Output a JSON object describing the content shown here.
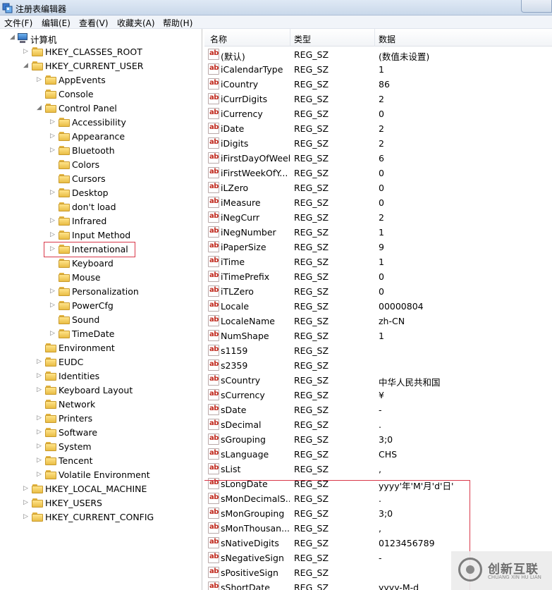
{
  "window": {
    "title": "注册表编辑器"
  },
  "menu": [
    "文件(F)",
    "编辑(E)",
    "查看(V)",
    "收藏夹(A)",
    "帮助(H)"
  ],
  "tree": [
    {
      "label": "计算机",
      "level": 0,
      "expander": "open",
      "kind": "computer"
    },
    {
      "label": "HKEY_CLASSES_ROOT",
      "level": 1,
      "expander": "closed"
    },
    {
      "label": "HKEY_CURRENT_USER",
      "level": 1,
      "expander": "open"
    },
    {
      "label": "AppEvents",
      "level": 2,
      "expander": "closed"
    },
    {
      "label": "Console",
      "level": 2,
      "expander": "none"
    },
    {
      "label": "Control Panel",
      "level": 2,
      "expander": "open"
    },
    {
      "label": "Accessibility",
      "level": 3,
      "expander": "closed"
    },
    {
      "label": "Appearance",
      "level": 3,
      "expander": "closed"
    },
    {
      "label": "Bluetooth",
      "level": 3,
      "expander": "closed"
    },
    {
      "label": "Colors",
      "level": 3,
      "expander": "none"
    },
    {
      "label": "Cursors",
      "level": 3,
      "expander": "none"
    },
    {
      "label": "Desktop",
      "level": 3,
      "expander": "closed"
    },
    {
      "label": "don't load",
      "level": 3,
      "expander": "none"
    },
    {
      "label": "Infrared",
      "level": 3,
      "expander": "closed"
    },
    {
      "label": "Input Method",
      "level": 3,
      "expander": "closed"
    },
    {
      "label": "International",
      "level": 3,
      "expander": "closed",
      "selected": true
    },
    {
      "label": "Keyboard",
      "level": 3,
      "expander": "none"
    },
    {
      "label": "Mouse",
      "level": 3,
      "expander": "none"
    },
    {
      "label": "Personalization",
      "level": 3,
      "expander": "closed"
    },
    {
      "label": "PowerCfg",
      "level": 3,
      "expander": "closed"
    },
    {
      "label": "Sound",
      "level": 3,
      "expander": "none"
    },
    {
      "label": "TimeDate",
      "level": 3,
      "expander": "closed"
    },
    {
      "label": "Environment",
      "level": 2,
      "expander": "none"
    },
    {
      "label": "EUDC",
      "level": 2,
      "expander": "closed"
    },
    {
      "label": "Identities",
      "level": 2,
      "expander": "closed"
    },
    {
      "label": "Keyboard Layout",
      "level": 2,
      "expander": "closed"
    },
    {
      "label": "Network",
      "level": 2,
      "expander": "none"
    },
    {
      "label": "Printers",
      "level": 2,
      "expander": "closed"
    },
    {
      "label": "Software",
      "level": 2,
      "expander": "closed"
    },
    {
      "label": "System",
      "level": 2,
      "expander": "closed"
    },
    {
      "label": "Tencent",
      "level": 2,
      "expander": "closed"
    },
    {
      "label": "Volatile Environment",
      "level": 2,
      "expander": "closed"
    },
    {
      "label": "HKEY_LOCAL_MACHINE",
      "level": 1,
      "expander": "closed"
    },
    {
      "label": "HKEY_USERS",
      "level": 1,
      "expander": "closed"
    },
    {
      "label": "HKEY_CURRENT_CONFIG",
      "level": 1,
      "expander": "closed"
    }
  ],
  "columns": [
    "名称",
    "类型",
    "数据"
  ],
  "values": [
    {
      "name": "(默认)",
      "type": "REG_SZ",
      "data": "(数值未设置)"
    },
    {
      "name": "iCalendarType",
      "type": "REG_SZ",
      "data": "1"
    },
    {
      "name": "iCountry",
      "type": "REG_SZ",
      "data": "86"
    },
    {
      "name": "iCurrDigits",
      "type": "REG_SZ",
      "data": "2"
    },
    {
      "name": "iCurrency",
      "type": "REG_SZ",
      "data": "0"
    },
    {
      "name": "iDate",
      "type": "REG_SZ",
      "data": "2"
    },
    {
      "name": "iDigits",
      "type": "REG_SZ",
      "data": "2"
    },
    {
      "name": "iFirstDayOfWeek",
      "type": "REG_SZ",
      "data": "6"
    },
    {
      "name": "iFirstWeekOfY...",
      "type": "REG_SZ",
      "data": "0"
    },
    {
      "name": "iLZero",
      "type": "REG_SZ",
      "data": "0"
    },
    {
      "name": "iMeasure",
      "type": "REG_SZ",
      "data": "0"
    },
    {
      "name": "iNegCurr",
      "type": "REG_SZ",
      "data": "2"
    },
    {
      "name": "iNegNumber",
      "type": "REG_SZ",
      "data": "1"
    },
    {
      "name": "iPaperSize",
      "type": "REG_SZ",
      "data": "9"
    },
    {
      "name": "iTime",
      "type": "REG_SZ",
      "data": "1"
    },
    {
      "name": "iTimePrefix",
      "type": "REG_SZ",
      "data": "0"
    },
    {
      "name": "iTLZero",
      "type": "REG_SZ",
      "data": "0"
    },
    {
      "name": "Locale",
      "type": "REG_SZ",
      "data": "00000804"
    },
    {
      "name": "LocaleName",
      "type": "REG_SZ",
      "data": "zh-CN"
    },
    {
      "name": "NumShape",
      "type": "REG_SZ",
      "data": "1"
    },
    {
      "name": "s1159",
      "type": "REG_SZ",
      "data": ""
    },
    {
      "name": "s2359",
      "type": "REG_SZ",
      "data": ""
    },
    {
      "name": "sCountry",
      "type": "REG_SZ",
      "data": "中华人民共和国"
    },
    {
      "name": "sCurrency",
      "type": "REG_SZ",
      "data": "¥"
    },
    {
      "name": "sDate",
      "type": "REG_SZ",
      "data": "-"
    },
    {
      "name": "sDecimal",
      "type": "REG_SZ",
      "data": "."
    },
    {
      "name": "sGrouping",
      "type": "REG_SZ",
      "data": "3;0"
    },
    {
      "name": "sLanguage",
      "type": "REG_SZ",
      "data": "CHS"
    },
    {
      "name": "sList",
      "type": "REG_SZ",
      "data": ","
    },
    {
      "name": "sLongDate",
      "type": "REG_SZ",
      "data": "yyyy'年'M'月'd'日'"
    },
    {
      "name": "sMonDecimalS...",
      "type": "REG_SZ",
      "data": "."
    },
    {
      "name": "sMonGrouping",
      "type": "REG_SZ",
      "data": "3;0"
    },
    {
      "name": "sMonThousan...",
      "type": "REG_SZ",
      "data": ","
    },
    {
      "name": "sNativeDigits",
      "type": "REG_SZ",
      "data": "0123456789"
    },
    {
      "name": "sNegativeSign",
      "type": "REG_SZ",
      "data": "-"
    },
    {
      "name": "sPositiveSign",
      "type": "REG_SZ",
      "data": ""
    },
    {
      "name": "sShortDate",
      "type": "REG_SZ",
      "data": "yyyy-M-d"
    }
  ],
  "watermark": {
    "cn": "创新互联",
    "en": "CHUANG XIN HU LIAN"
  },
  "colors": {
    "highlight": "#d9384a",
    "folder": "#f1c94e",
    "string_icon": "#c0281c"
  }
}
